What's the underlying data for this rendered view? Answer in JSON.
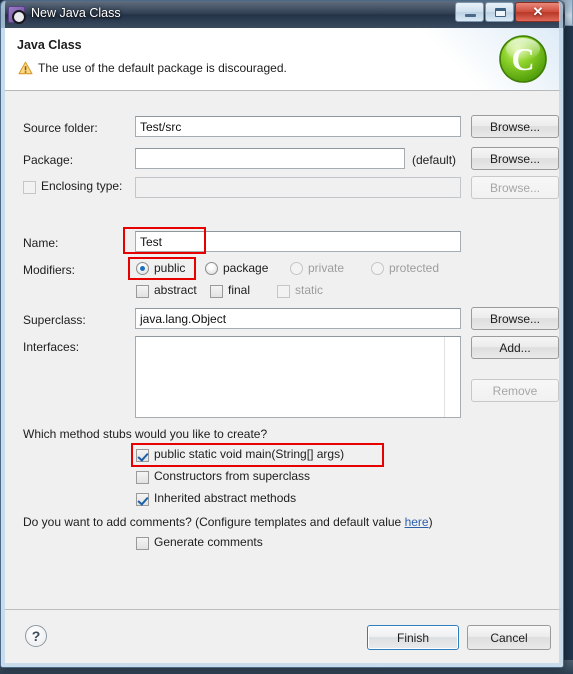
{
  "window": {
    "title": "New Java Class",
    "icon": "gear-icon",
    "minimize_label": "",
    "restore_label": "",
    "close_label": "✕"
  },
  "header": {
    "title": "Java Class",
    "message": "The use of the default package is discouraged.",
    "warning_icon": "warning-triangle-icon",
    "logo_letter": "C",
    "logo_color": "#6cc11a"
  },
  "form": {
    "source_folder": {
      "label": "Source folder:",
      "value": "Test/src",
      "browse_label": "Browse..."
    },
    "package": {
      "label": "Package:",
      "value": "",
      "default_note": "(default)",
      "browse_label": "Browse..."
    },
    "enclosing_type": {
      "label": "Enclosing type:",
      "checked": false,
      "value": "",
      "browse_label": "Browse...",
      "enabled": false
    },
    "name": {
      "label": "Name:",
      "value": "Test"
    },
    "modifiers": {
      "label": "Modifiers:",
      "radios": [
        {
          "label": "public",
          "checked": true,
          "enabled": true
        },
        {
          "label": "package",
          "checked": false,
          "enabled": true
        },
        {
          "label": "private",
          "checked": false,
          "enabled": false
        },
        {
          "label": "protected",
          "checked": false,
          "enabled": false
        }
      ],
      "checkboxes": [
        {
          "label": "abstract",
          "checked": false,
          "enabled": true
        },
        {
          "label": "final",
          "checked": false,
          "enabled": true
        },
        {
          "label": "static",
          "checked": false,
          "enabled": false
        }
      ]
    },
    "superclass": {
      "label": "Superclass:",
      "value": "java.lang.Object",
      "browse_label": "Browse..."
    },
    "interfaces": {
      "label": "Interfaces:",
      "items": [],
      "add_label": "Add...",
      "remove_label": "Remove",
      "remove_enabled": false
    }
  },
  "stubs": {
    "question": "Which method stubs would you like to create?",
    "options": [
      {
        "label": "public static void main(String[] args)",
        "checked": true
      },
      {
        "label": "Constructors from superclass",
        "checked": false
      },
      {
        "label": "Inherited abstract methods",
        "checked": true
      }
    ]
  },
  "comments": {
    "question_prefix": "Do you want to add comments? (Configure templates and default value ",
    "link_label": "here",
    "question_suffix": ")",
    "generate": {
      "label": "Generate comments",
      "checked": false
    }
  },
  "footer": {
    "help_label": "?",
    "finish_label": "Finish",
    "cancel_label": "Cancel"
  },
  "annotations": {
    "color": "#e60000",
    "boxes": [
      {
        "name": "name-field-highlight",
        "note": "Test"
      },
      {
        "name": "public-radio-highlight",
        "note": "public"
      },
      {
        "name": "main-method-highlight",
        "note": "public static void main(String[] args)"
      }
    ]
  }
}
